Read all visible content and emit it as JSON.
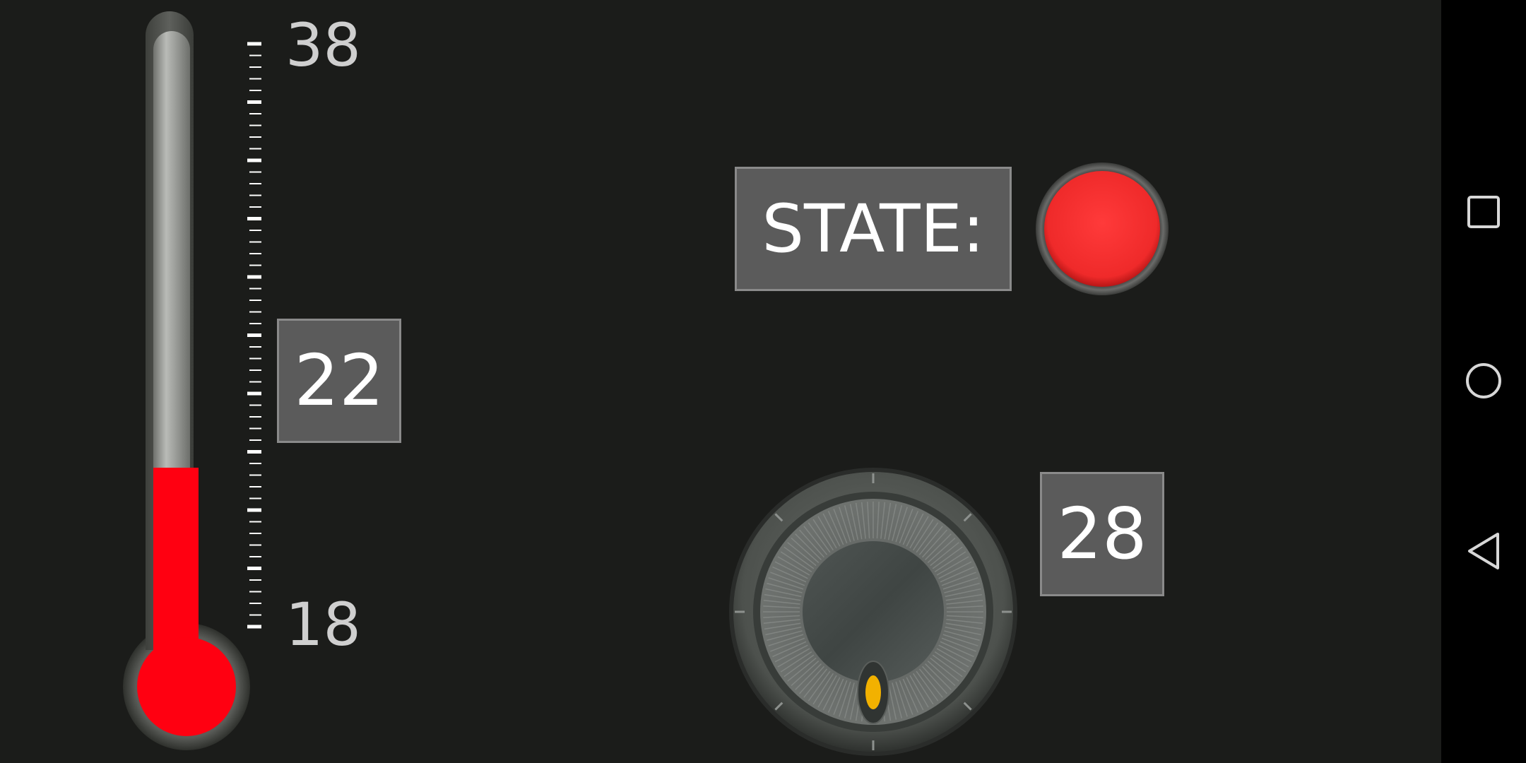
{
  "thermometer": {
    "max_label": "38",
    "min_label": "18",
    "value": 22,
    "min": 18,
    "max": 38,
    "value_text": "22",
    "fill_color": "#ff0011"
  },
  "state": {
    "label": "STATE:",
    "indicator_color": "#f22a2a"
  },
  "knob": {
    "value_text": "28",
    "indicator_color": "#f2b100"
  },
  "navbar": {
    "recents_icon": "square-icon",
    "home_icon": "circle-icon",
    "back_icon": "triangle-back-icon"
  }
}
